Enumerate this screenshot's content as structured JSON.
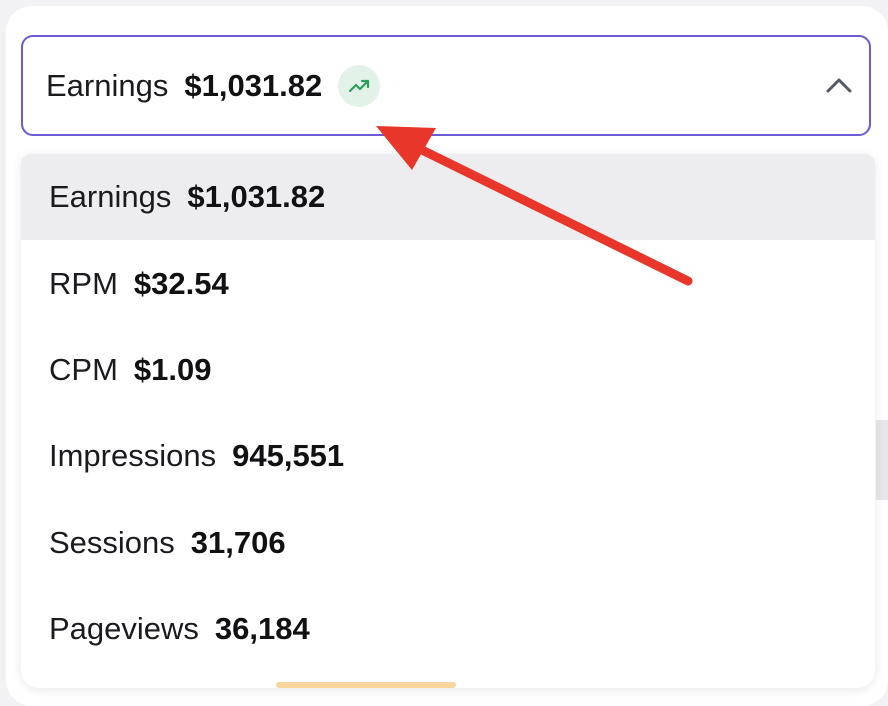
{
  "selector": {
    "label": "Earnings",
    "value": "$1,031.82",
    "trend_icon": "trending-up-icon",
    "chevron_icon": "chevron-up-icon"
  },
  "options": [
    {
      "label": "Earnings",
      "value": "$1,031.82",
      "selected": true
    },
    {
      "label": "RPM",
      "value": "$32.54",
      "selected": false
    },
    {
      "label": "CPM",
      "value": "$1.09",
      "selected": false
    },
    {
      "label": "Impressions",
      "value": "945,551",
      "selected": false
    },
    {
      "label": "Sessions",
      "value": "31,706",
      "selected": false
    },
    {
      "label": "Pageviews",
      "value": "36,184",
      "selected": false
    }
  ],
  "colors": {
    "accent_border": "#6b5bd4",
    "trend_green": "#2e9e5b",
    "annotation_arrow": "#e8362b"
  }
}
